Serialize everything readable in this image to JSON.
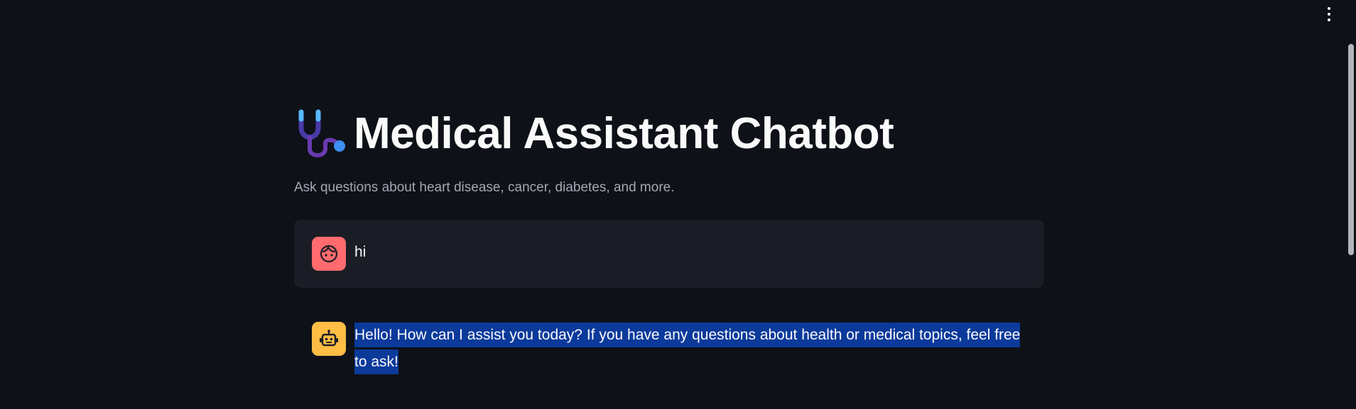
{
  "header": {
    "menu_icon": "kebab-vertical-icon"
  },
  "page": {
    "title_icon": "stethoscope-icon",
    "title": "Medical Assistant Chatbot",
    "subtitle": "Ask questions about heart disease, cancer, diabetes, and more."
  },
  "messages": [
    {
      "role": "user",
      "avatar_icon": "face-icon",
      "avatar_color": "#ff6b6e",
      "text": "hi"
    },
    {
      "role": "assistant",
      "avatar_icon": "robot-icon",
      "avatar_color": "#ffbd45",
      "text": "Hello! How can I assist you today? If you have any questions about health or medical topics, feel free to ask!"
    }
  ],
  "colors": {
    "background": "#0e1117",
    "user_bubble": "#1b1d26",
    "selection": "#0b3a9b"
  }
}
